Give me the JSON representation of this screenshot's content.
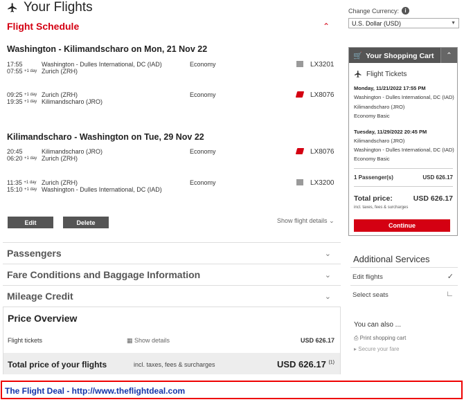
{
  "page_title": "Your Flights",
  "schedule": {
    "heading": "Flight Schedule",
    "outbound": {
      "title": "Washington - Kilimandscharo on Mon, 21 Nov 22",
      "segments": [
        {
          "dep_time": "17:55",
          "dep_day": "",
          "arr_time": "07:55",
          "arr_day": "+1 day",
          "from": "Washington - Dulles International, DC (IAD)",
          "to": "Zurich (ZRH)",
          "class": "Economy",
          "flight": "LX3201",
          "logo": "grey-airline-icon"
        },
        {
          "dep_time": "09:25",
          "dep_day": "+1 day",
          "arr_time": "19:35",
          "arr_day": "+1 day",
          "from": "Zurich (ZRH)",
          "to": "Kilimandscharo (JRO)",
          "class": "Economy",
          "flight": "LX8076",
          "logo": "swiss-airline-icon"
        }
      ]
    },
    "inbound": {
      "title": "Kilimandscharo - Washington on Tue, 29 Nov 22",
      "segments": [
        {
          "dep_time": "20:45",
          "dep_day": "",
          "arr_time": "06:20",
          "arr_day": "+1 day",
          "from": "Kilimandscharo (JRO)",
          "to": "Zurich (ZRH)",
          "class": "Economy",
          "flight": "LX8076",
          "logo": "swiss-airline-icon"
        },
        {
          "dep_time": "11:35",
          "dep_day": "+1 day",
          "arr_time": "15:10",
          "arr_day": "+1 day",
          "from": "Zurich (ZRH)",
          "to": "Washington - Dulles International, DC (IAD)",
          "class": "Economy",
          "flight": "LX3200",
          "logo": "grey-airline-icon"
        }
      ]
    },
    "edit_label": "Edit",
    "delete_label": "Delete",
    "show_details": "Show flight details"
  },
  "accordions": {
    "passengers": "Passengers",
    "fare": "Fare Conditions and Baggage Information",
    "mileage": "Mileage Credit"
  },
  "price_overview": {
    "heading": "Price Overview",
    "flight_tickets_label": "Flight tickets",
    "show_details": "Show details",
    "flight_tickets_amount": "USD 626.17",
    "total_label": "Total price of your flights",
    "total_incl": "incl. taxes, fees & surcharges",
    "total_amount": "USD 626.17",
    "total_note": "(1)"
  },
  "footer_text": "The Flight Deal - http://www.theflightdeal.com",
  "sidebar": {
    "currency_label": "Change Currency:",
    "currency_value": "U.S. Dollar (USD)",
    "cart": {
      "title": "Your Shopping Cart",
      "flight_tickets": "Flight Tickets",
      "out_date": "Monday, 11/21/2022 17:55 PM",
      "out_from": "Washington - Dulles International, DC (IAD)",
      "out_to": "Kilimandscharo (JRO)",
      "out_fare": "Economy Basic",
      "in_date": "Tuesday, 11/29/2022 20:45 PM",
      "in_from": "Kilimandscharo (JRO)",
      "in_to": "Washington - Dulles International, DC (IAD)",
      "in_fare": "Economy Basic",
      "passengers_label": "1 Passenger(s)",
      "passengers_amount": "USD 626.17",
      "total_label": "Total price:",
      "total_amount": "USD 626.17",
      "incl": "incl. taxes, fees & surcharges",
      "continue_label": "Continue"
    },
    "additional": {
      "title": "Additional Services",
      "edit_flights": "Edit flights",
      "select_seats": "Select seats"
    },
    "also": {
      "title": "You can also ...",
      "print": "Print shopping cart",
      "secure": "Secure your fare"
    }
  },
  "colors": {
    "accent": "#d40012",
    "dark": "#555555",
    "footer_link": "#1133aa"
  }
}
